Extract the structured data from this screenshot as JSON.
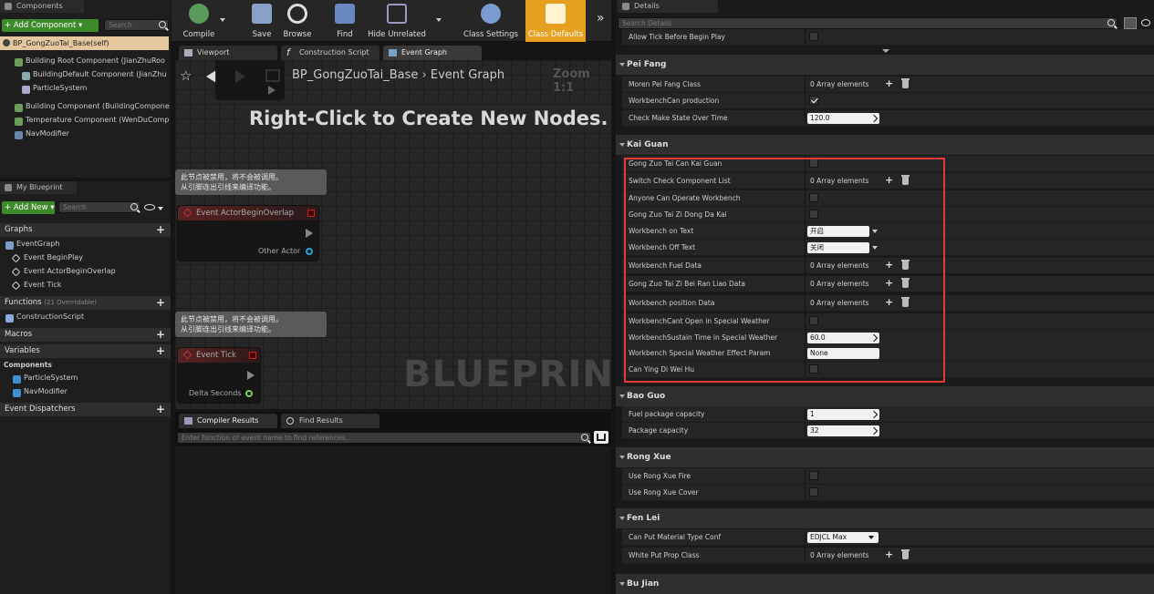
{
  "components": {
    "tab": "Components",
    "add_button": "+ Add Component ▾",
    "search_placeholder": "Search",
    "root": "BP_GongZuoTai_Base(self)",
    "items": [
      "Building Root Component (JianZhuRoo",
      "BuildingDefault Component (JianZhu",
      "ParticleSystem",
      "Building Component (BuildingCompone",
      "Temperature Component (WenDuComp",
      "NavModifier"
    ]
  },
  "myblueprint": {
    "tab": "My Blueprint",
    "add_button": "+ Add New ▾",
    "search_placeholder": "Search",
    "graphs_label": "Graphs",
    "eventgraph": "EventGraph",
    "events": [
      "Event BeginPlay",
      "Event ActorBeginOverlap",
      "Event Tick"
    ],
    "functions_label": "Functions",
    "functions_sub": "(21 Overridable)",
    "construction": "ConstructionScript",
    "macros_label": "Macros",
    "variables_label": "Variables",
    "components_label": "Components",
    "var_items": [
      "ParticleSystem",
      "NavModifier"
    ],
    "dispatchers_label": "Event Dispatchers"
  },
  "toolbar": {
    "compile": "Compile",
    "save": "Save",
    "browse": "Browse",
    "find": "Find",
    "hide_unrelated": "Hide Unrelated",
    "class_settings": "Class Settings",
    "class_defaults": "Class Defaults",
    "more": "»"
  },
  "graph_tabs": [
    "Viewport",
    "Construction Script",
    "Event Graph"
  ],
  "graph": {
    "breadcrumb_bp": "BP_GongZuoTai_Base",
    "breadcrumb_graph": "Event Graph",
    "zoom": "Zoom 1:1",
    "hint": "Right-Click to Create New Nodes.",
    "watermark": "BLUEPRINT",
    "disabled_note_1": "此节点被禁用，将不会被调用。",
    "disabled_note_2": "从引脚连出引线来编译功能。",
    "node_overlap": "Event ActorBeginOverlap",
    "pin_other_actor": "Other Actor",
    "node_tick": "Event Tick",
    "pin_delta": "Delta Seconds",
    "node_top_partial": "Event BeginPlay"
  },
  "bottom_tabs": [
    "Compiler Results",
    "Find Results"
  ],
  "find": {
    "placeholder": "Enter function or event name to find references..."
  },
  "details": {
    "tab": "Details",
    "search_placeholder": "Search Details",
    "allow_tick": "Allow Tick Before Begin Play",
    "cats": [
      "Pei Fang",
      "Kai Guan",
      "Bao Guo",
      "Rong Xue",
      "Fen Lei",
      "Bu Jian"
    ],
    "peifang": [
      {
        "name": "Moren Pei Fang Class",
        "value": "0 Array elements"
      },
      {
        "name": "WorkbenchCan production",
        "value": ""
      },
      {
        "name": "Check Make State Over Time",
        "value": "120.0"
      }
    ],
    "kaiguan": [
      {
        "name": "Gong Zuo Tai Can Kai Guan",
        "value": ""
      },
      {
        "name": "Switch Check Component List",
        "value": "0 Array elements"
      },
      {
        "name": "Anyone Can Operate Workbench",
        "value": ""
      },
      {
        "name": "Gong Zuo Tai Zi Dong Da Kai",
        "value": ""
      },
      {
        "name": "Workbench on Text",
        "value": "开启"
      },
      {
        "name": "Workbench Off Text",
        "value": "关闭"
      },
      {
        "name": "Workbench Fuel Data",
        "value": "0 Array elements"
      },
      {
        "name": "Gong Zuo Tai Zi Bei Ran Liao Data",
        "value": "0 Array elements"
      },
      {
        "name": "Workbench position Data",
        "value": "0 Array elements"
      },
      {
        "name": "WorkbenchCant Open in Special Weather",
        "value": ""
      },
      {
        "name": "WorkbenchSustain Time in Special Weather",
        "value": "60.0"
      },
      {
        "name": "Workbench Special Weather Effect Param",
        "value": "None"
      },
      {
        "name": "Can Ying Di Wei Hu",
        "value": ""
      }
    ],
    "baoguo": [
      {
        "name": "Fuel package capacity",
        "value": "1"
      },
      {
        "name": "Package capacity",
        "value": "32"
      }
    ],
    "rongxue": [
      {
        "name": "Use Rong Xue Fire",
        "value": ""
      },
      {
        "name": "Use Rong Xue Cover",
        "value": ""
      }
    ],
    "fenlei": [
      {
        "name": "Can Put Material Type Conf",
        "value": "EDJCL Max"
      },
      {
        "name": "White Put Prop Class",
        "value": "0 Array elements"
      }
    ]
  },
  "colors": {
    "accent": "#e6a020",
    "green": "#3d8a2a",
    "highlight": "#e53a3a"
  }
}
